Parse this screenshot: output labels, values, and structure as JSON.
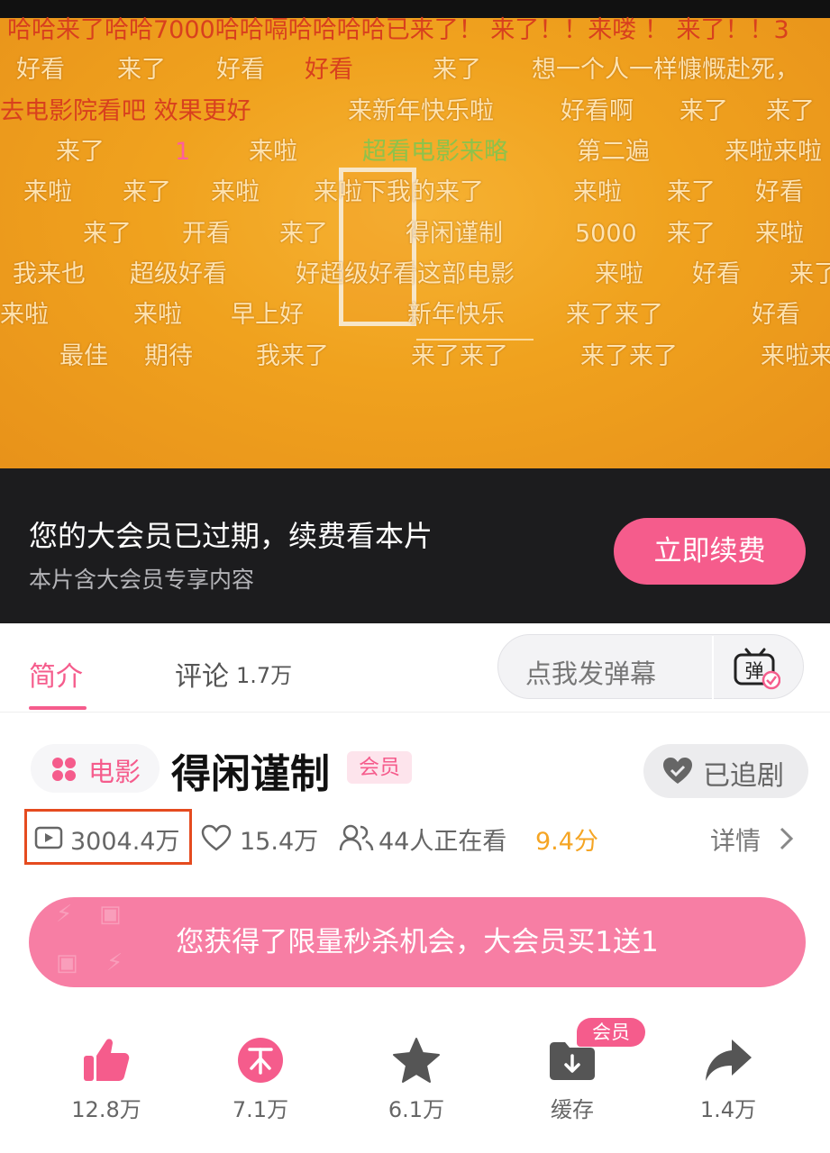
{
  "danmaku": [
    {
      "text": "哈哈来了哈哈7000哈哈嗝哈哈哈哈已来了！ 来了！！来喽 ！ 来了！！3",
      "style": "red"
    },
    {
      "text": "好看",
      "style": "light"
    },
    {
      "text": "来了",
      "style": "light"
    },
    {
      "text": "好看",
      "style": "light"
    },
    {
      "text": "好看",
      "style": "red"
    },
    {
      "text": "来了",
      "style": "light"
    },
    {
      "text": "想一个人一样慷慨赴死，",
      "style": "light"
    },
    {
      "text": "去电影院看吧 效果更好",
      "style": "red"
    },
    {
      "text": "来新年快乐啦",
      "style": "light"
    },
    {
      "text": "好看啊",
      "style": "light"
    },
    {
      "text": "来了",
      "style": "light"
    },
    {
      "text": "来了",
      "style": "light"
    },
    {
      "text": "来了",
      "style": "light"
    },
    {
      "text": "1",
      "style": "pink"
    },
    {
      "text": "来啦",
      "style": "light"
    },
    {
      "text": "超看电影来略",
      "style": "green"
    },
    {
      "text": "第二遍",
      "style": "light"
    },
    {
      "text": "来啦来啦",
      "style": "light"
    },
    {
      "text": "来啦",
      "style": "light"
    },
    {
      "text": "来了",
      "style": "light"
    },
    {
      "text": "来啦",
      "style": "light"
    },
    {
      "text": "来啦下我的来了",
      "style": "light"
    },
    {
      "text": "来啦",
      "style": "light"
    },
    {
      "text": "来了",
      "style": "light"
    },
    {
      "text": "好看",
      "style": "light"
    },
    {
      "text": "来了",
      "style": "light"
    },
    {
      "text": "开看",
      "style": "light"
    },
    {
      "text": "来了",
      "style": "light"
    },
    {
      "text": "得闲谨制",
      "style": "light"
    },
    {
      "text": "5000",
      "style": "light"
    },
    {
      "text": "来了",
      "style": "light"
    },
    {
      "text": "来啦",
      "style": "light"
    },
    {
      "text": "我来也",
      "style": "light"
    },
    {
      "text": "超级好看",
      "style": "light"
    },
    {
      "text": "好超级好看这部电影",
      "style": "light"
    },
    {
      "text": "来啦",
      "style": "light"
    },
    {
      "text": "好看",
      "style": "light"
    },
    {
      "text": "来了",
      "style": "light"
    },
    {
      "text": "来啦",
      "style": "light"
    },
    {
      "text": "来啦",
      "style": "light"
    },
    {
      "text": "早上好",
      "style": "light"
    },
    {
      "text": "新年快乐",
      "style": "light"
    },
    {
      "text": "来了来了",
      "style": "light"
    },
    {
      "text": "好看",
      "style": "light"
    },
    {
      "text": "最佳",
      "style": "light"
    },
    {
      "text": "期待",
      "style": "light"
    },
    {
      "text": "我来了",
      "style": "light"
    },
    {
      "text": "来了来了",
      "style": "light"
    },
    {
      "text": "来了来了",
      "style": "light"
    },
    {
      "text": "来啦来",
      "style": "light"
    }
  ],
  "vip_notice": {
    "title": "您的大会员已过期，续费看本片",
    "subtitle": "本片含大会员专享内容",
    "renew_label": "立即续费"
  },
  "tabs": {
    "intro": "简介",
    "comments": "评论",
    "comments_count": "1.7万",
    "danmaku_placeholder": "点我发弹幕",
    "danmaku_icon_char": "弹"
  },
  "movie": {
    "category": "电影",
    "title": "得闲谨制",
    "badge": "会员",
    "follow_label": "已追剧",
    "views": "3004.4万",
    "likes": "15.4万",
    "watching": "44人正在看",
    "score": "9.4分",
    "details_label": "详情"
  },
  "promo": {
    "text": "您获得了限量秒杀机会，大会员买1送1"
  },
  "actions": {
    "like_count": "12.8万",
    "coin_count": "7.1万",
    "favorite_count": "6.1万",
    "cache_label": "缓存",
    "cache_badge": "会员",
    "share_count": "1.4万"
  },
  "colors": {
    "accent": "#f55c8c",
    "promo_bg": "#f77ea4",
    "score": "#f5a524",
    "highlight_box": "#e54b1f",
    "player_bg": "#f0a21e",
    "vip_bar_bg": "#1c1c1e"
  }
}
